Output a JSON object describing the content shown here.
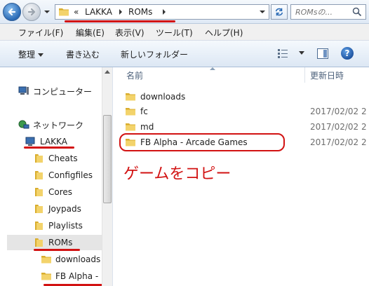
{
  "address": {
    "overflow": "«",
    "crumbs": [
      "LAKKA",
      "ROMs"
    ],
    "search_placeholder": "ROMsの..."
  },
  "menu": [
    "ファイル(F)",
    "編集(E)",
    "表示(V)",
    "ツール(T)",
    "ヘルプ(H)"
  ],
  "commands": {
    "organize": "整理",
    "burn": "書き込む",
    "new_folder": "新しいフォルダー"
  },
  "nav": {
    "computer": "コンピューター",
    "network": "ネットワーク",
    "lakka": "LAKKA",
    "folders": [
      "Cheats",
      "Configfiles",
      "Cores",
      "Joypads",
      "Playlists",
      "ROMs"
    ],
    "subfolders": [
      "downloads",
      "FB Alpha - ..."
    ]
  },
  "columns": {
    "name": "名前",
    "date": "更新日時"
  },
  "files": [
    {
      "name": "downloads",
      "date": ""
    },
    {
      "name": "fc",
      "date": "2017/02/02 2"
    },
    {
      "name": "md",
      "date": "2017/02/02 2"
    },
    {
      "name": "FB Alpha - Arcade Games",
      "date": "2017/02/02 2"
    }
  ],
  "annotation": "ゲームをコピー",
  "colors": {
    "annotation_red": "#d21212",
    "folder_yellow": "#e8c04a"
  }
}
